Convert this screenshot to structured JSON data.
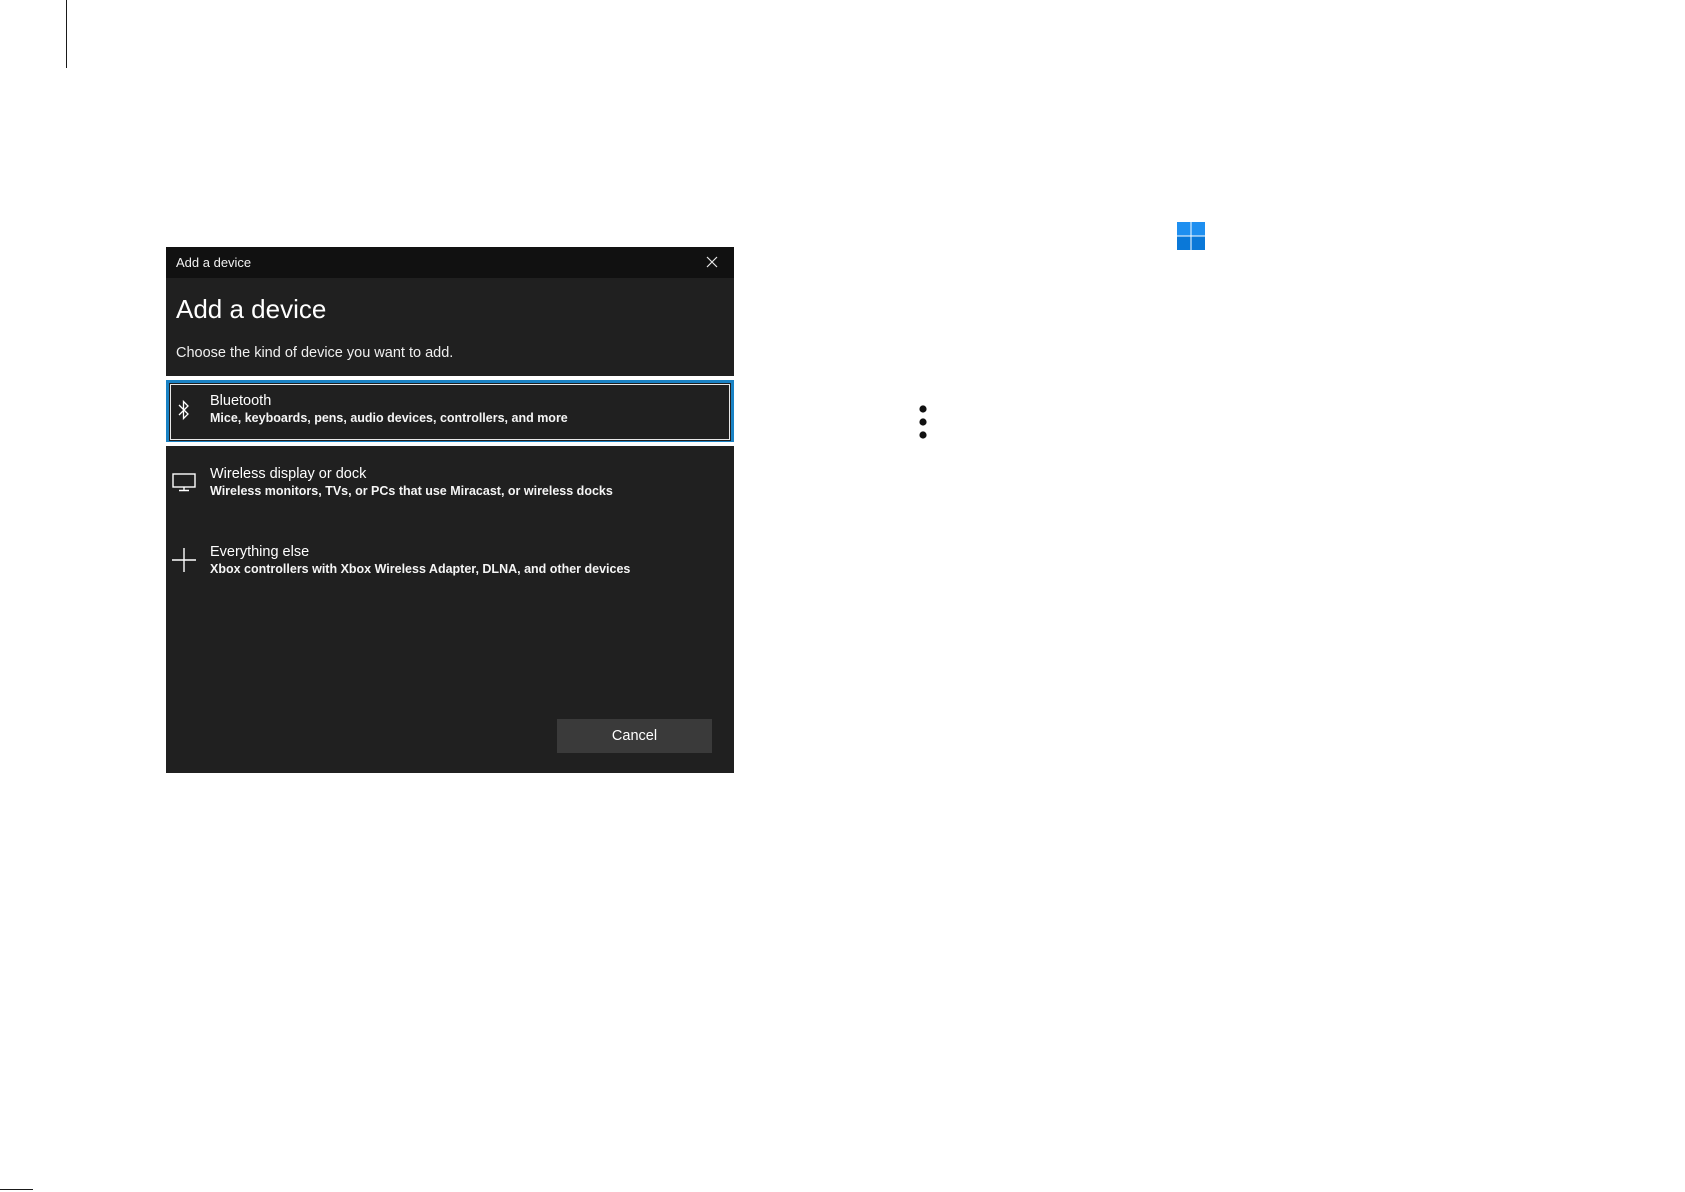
{
  "dialog": {
    "window_title": "Add a device",
    "heading": "Add a device",
    "subheading": "Choose the kind of device you want to add.",
    "options": [
      {
        "title": "Bluetooth",
        "description": "Mice, keyboards, pens, audio devices, controllers, and more",
        "icon": "bluetooth-icon"
      },
      {
        "title": "Wireless display or dock",
        "description": "Wireless monitors, TVs, or PCs that use Miracast, or wireless docks",
        "icon": "monitor-icon"
      },
      {
        "title": "Everything else",
        "description": "Xbox controllers with Xbox Wireless Adapter, DLNA, and other devices",
        "icon": "plus-icon"
      }
    ],
    "cancel_label": "Cancel"
  },
  "colors": {
    "dialog_background": "#202020",
    "titlebar_background": "#111111",
    "selection_border": "#1a82c4",
    "button_background": "#3a3a3a",
    "windows_logo": "#0a84e0"
  },
  "icons": {
    "windows": "windows-logo-icon",
    "more": "more-vertical-icon",
    "close": "close-icon"
  }
}
